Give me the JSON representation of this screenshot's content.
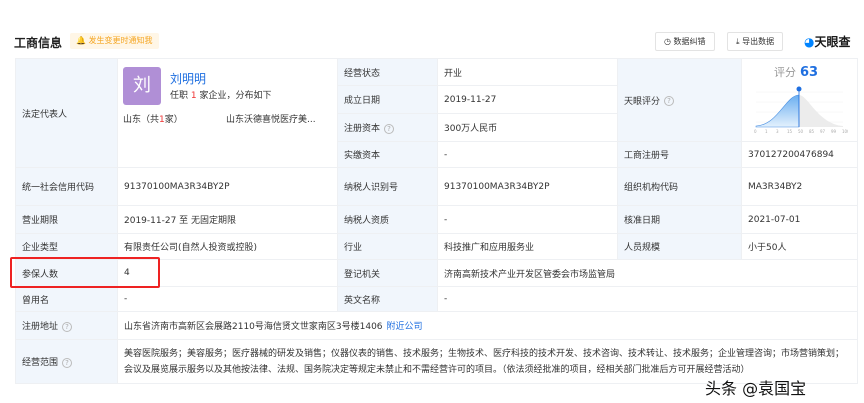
{
  "header": {
    "title": "工商信息",
    "notify": "发生变更时通知我",
    "btn_correct": "数据纠错",
    "btn_export": "导出数据",
    "logo": "天眼查"
  },
  "legal": {
    "label": "法定代表人",
    "avatar": "刘",
    "name": "刘明明",
    "job_pre": "任职 ",
    "job_count": "1",
    "job_post": " 家企业，分布如下",
    "prov_pre": "山东（共",
    "prov_count": "1",
    "prov_post": "家）",
    "company": "山东沃德喜悦医疗美..."
  },
  "rows": {
    "status": {
      "label": "经营状态",
      "value": "开业"
    },
    "found": {
      "label": "成立日期",
      "value": "2019-11-27"
    },
    "capital": {
      "label": "注册资本",
      "value": "300万人民币"
    },
    "paid": {
      "label": "实缴资本",
      "value": "-"
    },
    "score": {
      "label": "天眼评分",
      "title": "评分",
      "value": "63",
      "ticks": [
        "0",
        "1",
        "3",
        "15",
        "50",
        "85",
        "97",
        "99",
        "100"
      ]
    },
    "regno": {
      "label": "工商注册号",
      "value": "370127200476894"
    },
    "credit": {
      "label": "统一社会信用代码",
      "value": "91370100MA3R34BY2P"
    },
    "taxid": {
      "label": "纳税人识别号",
      "value": "91370100MA3R34BY2P"
    },
    "orgcode": {
      "label": "组织机构代码",
      "value": "MA3R34BY2"
    },
    "term": {
      "label": "营业期限",
      "value": "2019-11-27 至 无固定期限"
    },
    "taxqual": {
      "label": "纳税人资质",
      "value": "-"
    },
    "approve": {
      "label": "核准日期",
      "value": "2021-07-01"
    },
    "type": {
      "label": "企业类型",
      "value": "有限责任公司(自然人投资或控股)"
    },
    "industry": {
      "label": "行业",
      "value": "科技推广和应用服务业"
    },
    "size": {
      "label": "人员规模",
      "value": "小于50人"
    },
    "insured": {
      "label": "参保人数",
      "value": "4"
    },
    "authority": {
      "label": "登记机关",
      "value": "济南高新技术产业开发区管委会市场监管局"
    },
    "former": {
      "label": "曾用名",
      "value": "-"
    },
    "english": {
      "label": "英文名称",
      "value": "-"
    },
    "address": {
      "label": "注册地址",
      "value": "山东省济南市高新区会展路2110号海信贤文世家南区3号楼1406",
      "link": "附近公司"
    },
    "scope": {
      "label": "经营范围",
      "value": "美容医院服务；美容服务；医疗器械的研发及销售；仪器仪表的销售、技术服务；生物技术、医疗科技的技术开发、技术咨询、技术转让、技术服务；企业管理咨询；市场营销策划；会议及展览展示服务以及其他按法律、法规、国务院决定等规定未禁止和不需经营许可的项目。（依法须经批准的项目，经相关部门批准后方可开展经营活动）"
    }
  },
  "watermark": "头条 @袁国宝"
}
